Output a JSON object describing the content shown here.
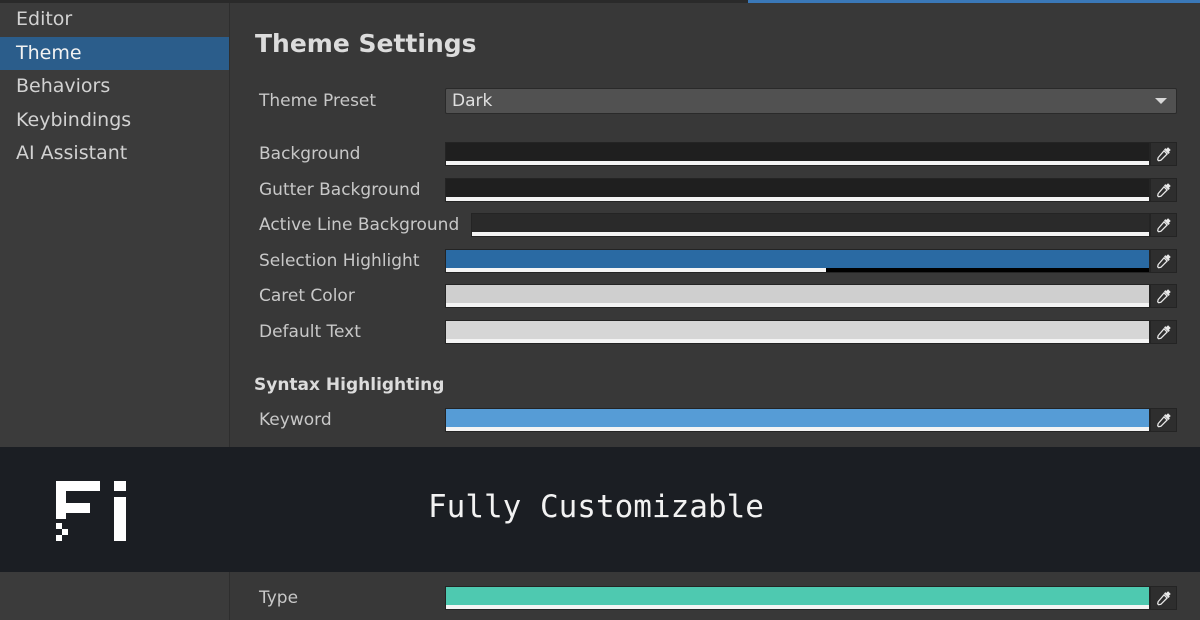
{
  "sidebar": {
    "items": [
      {
        "label": "Editor",
        "active": false
      },
      {
        "label": "Theme",
        "active": true
      },
      {
        "label": "Behaviors",
        "active": false
      },
      {
        "label": "Keybindings",
        "active": false
      },
      {
        "label": "AI Assistant",
        "active": false
      }
    ]
  },
  "main": {
    "title": "Theme Settings",
    "preset": {
      "label": "Theme Preset",
      "value": "Dark"
    },
    "colors": [
      {
        "label": "Background",
        "color": "#1f1f1f",
        "alpha": 1
      },
      {
        "label": "Gutter Background",
        "color": "#1f1f1f",
        "alpha": 1
      },
      {
        "label": "Active Line Background",
        "color": "#2a2a2a",
        "alpha": 1
      },
      {
        "label": "Selection Highlight",
        "color": "#2a6aa3",
        "alpha": 0.54
      },
      {
        "label": "Caret Color",
        "color": "#cfcfcf",
        "alpha": 1
      },
      {
        "label": "Default Text",
        "color": "#d6d6d6",
        "alpha": 1
      }
    ],
    "syntax_section": "Syntax Highlighting",
    "syntax": [
      {
        "label": "Keyword",
        "color": "#569cd6",
        "alpha": 1
      },
      {
        "label": "Type",
        "color": "#4ec9b0",
        "alpha": 1
      }
    ]
  },
  "banner": {
    "tagline": "Fully Customizable",
    "logo_icon": "fi-logo-icon"
  },
  "icons": {
    "eyedropper": "eyedropper-icon",
    "dropdown": "chevron-down-icon"
  },
  "colors": {
    "accent": "#2b5d8b",
    "banner_bg": "#1b1e23"
  }
}
